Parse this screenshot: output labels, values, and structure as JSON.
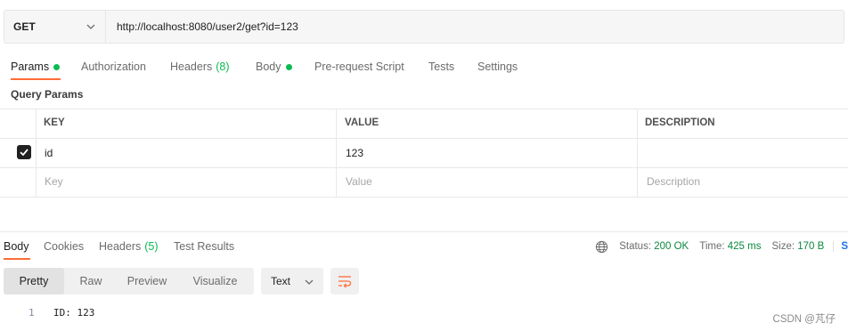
{
  "request": {
    "method": "GET",
    "url": "http://localhost:8080/user2/get?id=123"
  },
  "request_tabs": [
    {
      "label": "Params",
      "dot": true,
      "active": true
    },
    {
      "label": "Authorization"
    },
    {
      "label": "Headers",
      "count": "(8)"
    },
    {
      "label": "Body",
      "dot": true
    },
    {
      "label": "Pre-request Script"
    },
    {
      "label": "Tests"
    },
    {
      "label": "Settings"
    }
  ],
  "query_params": {
    "title": "Query Params",
    "columns": [
      "KEY",
      "VALUE",
      "DESCRIPTION"
    ],
    "rows": [
      {
        "checked": true,
        "key": "id",
        "value": "123",
        "description": ""
      }
    ],
    "placeholders": {
      "key": "Key",
      "value": "Value",
      "description": "Description"
    }
  },
  "response_tabs": [
    {
      "label": "Body",
      "active": true
    },
    {
      "label": "Cookies"
    },
    {
      "label": "Headers",
      "count": "(5)"
    },
    {
      "label": "Test Results"
    }
  ],
  "response_status": {
    "status_label": "Status:",
    "status_value": "200 OK",
    "time_label": "Time:",
    "time_value": "425 ms",
    "size_label": "Size:",
    "size_value": "170 B",
    "save_label": "S"
  },
  "view_modes": [
    "Pretty",
    "Raw",
    "Preview",
    "Visualize"
  ],
  "format": "Text",
  "response_body": {
    "line_number": "1",
    "text": "ID: 123"
  },
  "watermark": "CSDN @芃仔",
  "colors": {
    "accent": "#ff6c37",
    "success": "#0cbb52"
  },
  "icons": [
    "chevron-down-icon",
    "checkmark-icon",
    "globe-icon",
    "wrap-lines-icon"
  ]
}
